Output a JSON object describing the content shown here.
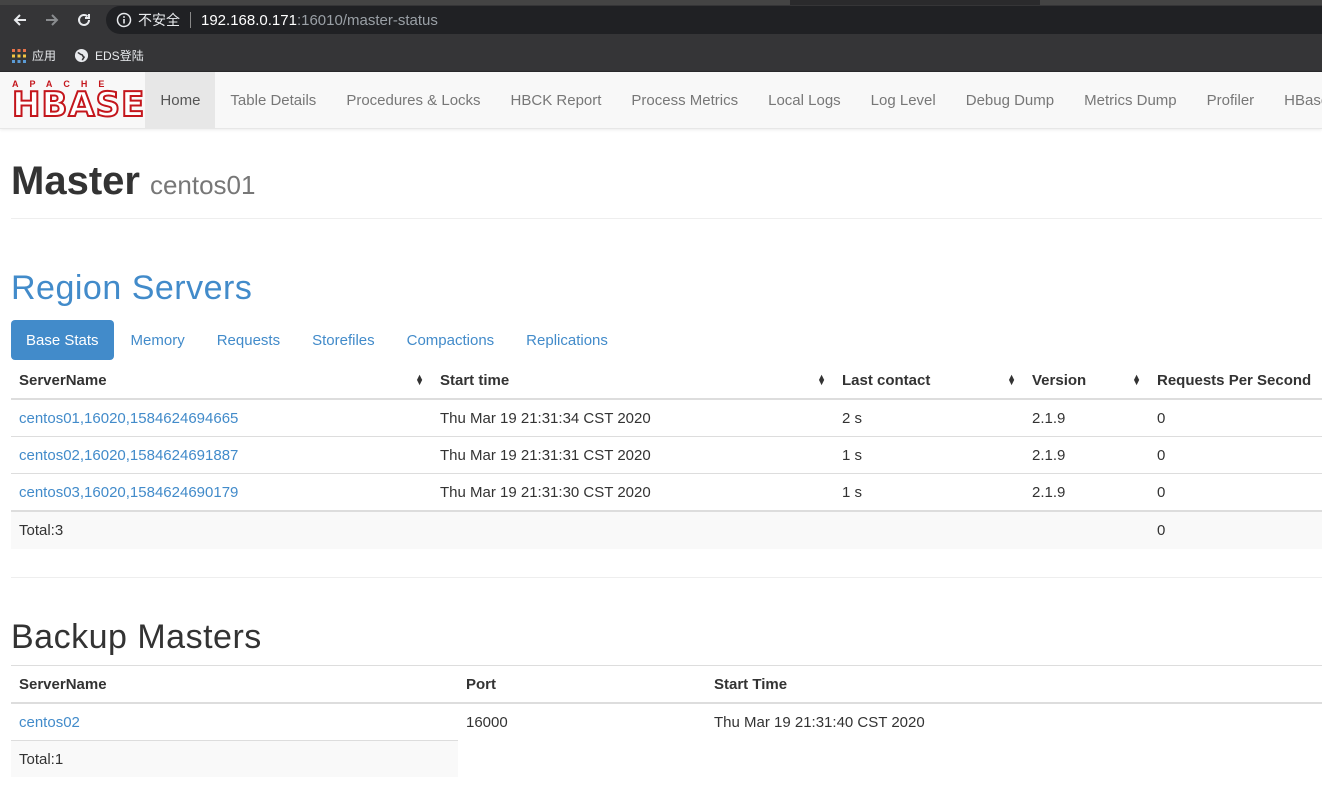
{
  "browser": {
    "insecure_label": "不安全",
    "url_host": "192.168.0.171",
    "url_path": ":16010/master-status",
    "bookmarks": [
      {
        "label": "应用",
        "icon": "apps-grid-icon"
      },
      {
        "label": "EDS登陆",
        "icon": "globe-icon"
      }
    ]
  },
  "logo": {
    "top": "APACHE",
    "main": "HBASE"
  },
  "nav": {
    "items": [
      {
        "label": "Home",
        "active": true
      },
      {
        "label": "Table Details"
      },
      {
        "label": "Procedures & Locks"
      },
      {
        "label": "HBCK Report"
      },
      {
        "label": "Process Metrics"
      },
      {
        "label": "Local Logs"
      },
      {
        "label": "Log Level"
      },
      {
        "label": "Debug Dump"
      },
      {
        "label": "Metrics Dump"
      },
      {
        "label": "Profiler"
      },
      {
        "label": "HBase Con"
      }
    ]
  },
  "header": {
    "title": "Master",
    "subtitle": "centos01"
  },
  "region_servers": {
    "title": "Region Servers",
    "tabs": [
      "Base Stats",
      "Memory",
      "Requests",
      "Storefiles",
      "Compactions",
      "Replications"
    ],
    "columns": [
      "ServerName",
      "Start time",
      "Last contact",
      "Version",
      "Requests Per Second"
    ],
    "rows": [
      {
        "server": "centos01,16020,1584624694665",
        "start": "Thu Mar 19 21:31:34 CST 2020",
        "contact": "2 s",
        "version": "2.1.9",
        "rps": "0"
      },
      {
        "server": "centos02,16020,1584624691887",
        "start": "Thu Mar 19 21:31:31 CST 2020",
        "contact": "1 s",
        "version": "2.1.9",
        "rps": "0"
      },
      {
        "server": "centos03,16020,1584624690179",
        "start": "Thu Mar 19 21:31:30 CST 2020",
        "contact": "1 s",
        "version": "2.1.9",
        "rps": "0"
      }
    ],
    "total_label": "Total:3",
    "total_rps": "0"
  },
  "backup_masters": {
    "title": "Backup Masters",
    "columns": [
      "ServerName",
      "Port",
      "Start Time"
    ],
    "rows": [
      {
        "server": "centos02",
        "port": "16000",
        "start": "Thu Mar 19 21:31:40 CST 2020"
      }
    ],
    "total_label": "Total:1"
  },
  "colors": {
    "link": "#428bca",
    "logo_red": "#c4161c"
  }
}
